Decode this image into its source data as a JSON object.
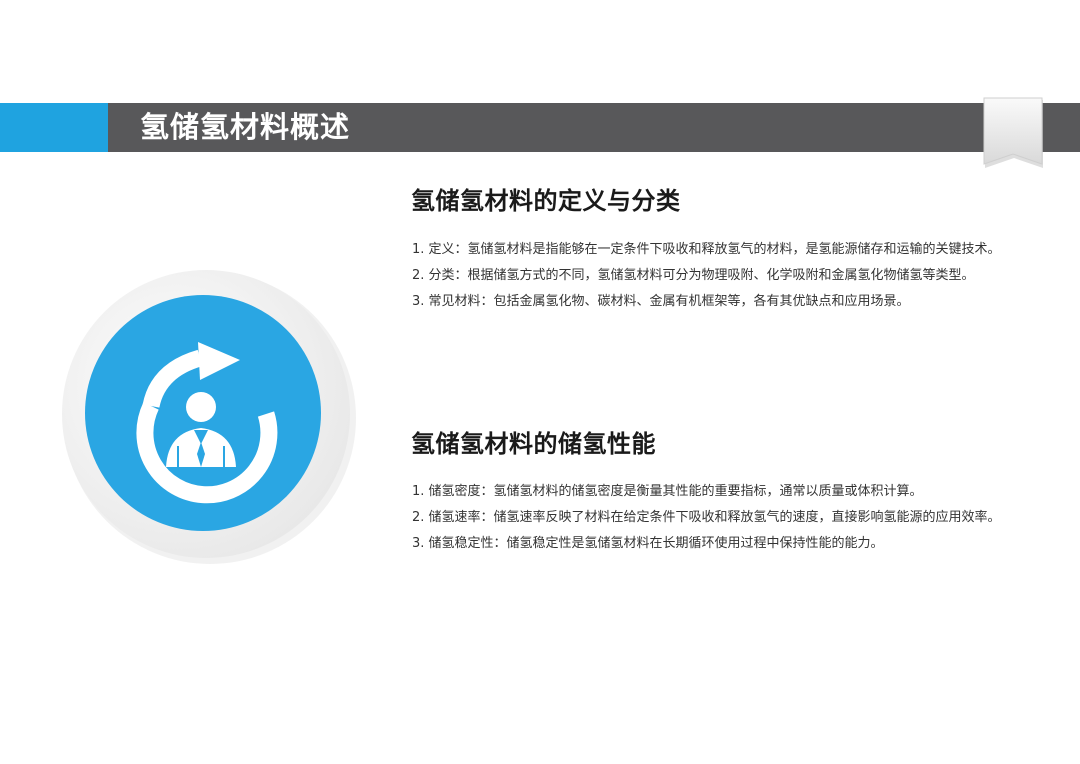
{
  "header": {
    "title": "氢储氢材料概述",
    "colors": {
      "bar": "#58585a",
      "accent": "#1fa3e0"
    },
    "bookmark_icon": "bookmark-ribbon-icon"
  },
  "illustration": {
    "icon": "person-refresh-icon",
    "colors": {
      "circle": "#2aa6e3",
      "ring": "#f1f1f1",
      "glyph": "#ffffff"
    }
  },
  "sections": [
    {
      "title": "氢储氢材料的定义与分类",
      "items": [
        "1. 定义：氢储氢材料是指能够在一定条件下吸收和释放氢气的材料，是氢能源储存和运输的关键技术。",
        "2. 分类：根据储氢方式的不同，氢储氢材料可分为物理吸附、化学吸附和金属氢化物储氢等类型。",
        "3. 常见材料：包括金属氢化物、碳材料、金属有机框架等，各有其优缺点和应用场景。"
      ]
    },
    {
      "title": "氢储氢材料的储氢性能",
      "items": [
        "1. 储氢密度：氢储氢材料的储氢密度是衡量其性能的重要指标，通常以质量或体积计算。",
        "2. 储氢速率：储氢速率反映了材料在给定条件下吸收和释放氢气的速度，直接影响氢能源的应用效率。",
        "3. 储氢稳定性：储氢稳定性是氢储氢材料在长期循环使用过程中保持性能的能力。"
      ]
    }
  ]
}
